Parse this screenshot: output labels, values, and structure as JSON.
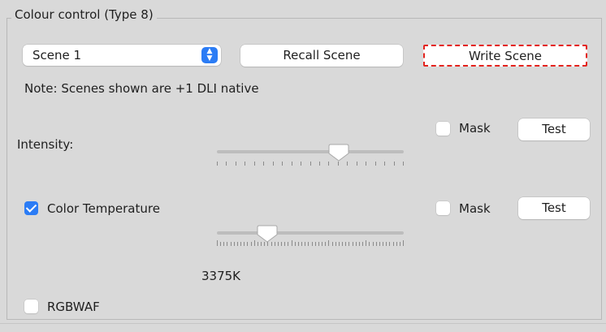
{
  "group": {
    "title": "Colour control (Type 8)"
  },
  "scene_select": {
    "value": "Scene 1"
  },
  "buttons": {
    "recall": "Recall Scene",
    "write": "Write Scene"
  },
  "note": "Note: Scenes shown are +1 DLI native",
  "intensity": {
    "label": "Intensity:",
    "mask_label": "Mask",
    "mask_checked": false,
    "test_label": "Test",
    "slider_fraction": 0.65
  },
  "color_temperature": {
    "label": "Color Temperature",
    "checked": true,
    "mask_label": "Mask",
    "mask_checked": false,
    "test_label": "Test",
    "slider_fraction": 0.27,
    "value_text": "3375K"
  },
  "rgbwaf": {
    "label": "RGBWAF",
    "checked": false
  },
  "colors": {
    "accent": "#2b7cf5",
    "focus_border": "#e3231d",
    "background": "#d9d9d9"
  }
}
